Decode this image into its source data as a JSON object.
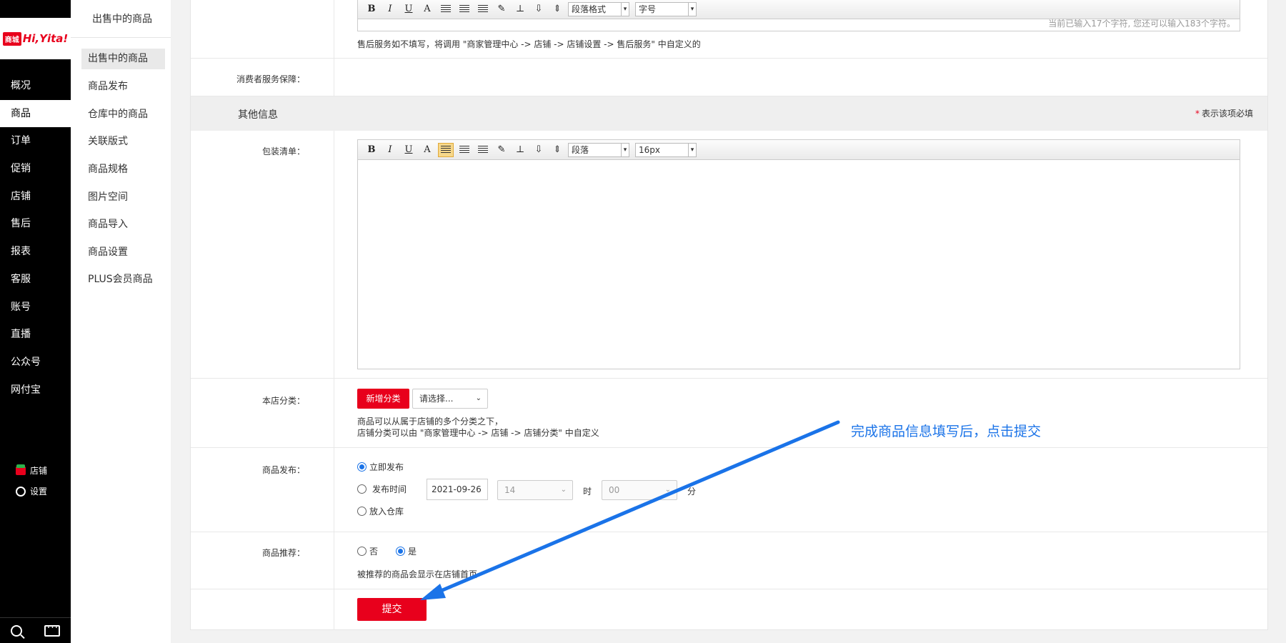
{
  "logo": {
    "mark": "商城",
    "text": "Hi,Yita!"
  },
  "main_nav": [
    "概况",
    "商品",
    "订单",
    "促销",
    "店铺",
    "售后",
    "报表",
    "客服",
    "账号",
    "直播",
    "公众号",
    "网付宝"
  ],
  "bottom_links": {
    "store": "店铺",
    "settings": "设置"
  },
  "subnav": {
    "title": "出售中的商品",
    "items": [
      "出售中的商品",
      "商品发布",
      "仓库中的商品",
      "关联版式",
      "商品规格",
      "图片空间",
      "商品导入",
      "商品设置",
      "PLUS会员商品"
    ]
  },
  "top_editor": {
    "format_select": "段落格式",
    "size_select": "字号",
    "char_count": "当前已输入17个字符, 您还可以输入183个字符。",
    "hint": "售后服务如不填写，将调用 \"商家管理中心 -> 店铺 -> 店铺设置 -> 售后服务\" 中自定义的"
  },
  "consumer_guarantee": {
    "label": "消费者服务保障："
  },
  "other_info": {
    "title": "其他信息",
    "required_star": "*",
    "required_note": "表示该项必填"
  },
  "packing_list": {
    "label": "包装清单：",
    "format_select": "段落",
    "size_select": "16px"
  },
  "toolbar_glyphs": {
    "bold": "B",
    "italic": "I",
    "underline": "U",
    "font_color": "A"
  },
  "store_category": {
    "label": "本店分类：",
    "add_button": "新增分类",
    "select_placeholder": "请选择...",
    "hint_line1": "商品可以从属于店铺的多个分类之下，",
    "hint_line2": "店铺分类可以由 \"商家管理中心 -> 店铺 -> 店铺分类\" 中自定义"
  },
  "publish": {
    "label": "商品发布：",
    "opt_now": "立即发布",
    "opt_time": "发布时间",
    "date": "2021-09-26",
    "hour": "14",
    "hour_unit": "时",
    "minute": "00",
    "minute_unit": "分",
    "opt_warehouse": "放入仓库",
    "selected": "now"
  },
  "recommend": {
    "label": "商品推荐：",
    "opt_no": "否",
    "opt_yes": "是",
    "selected": "yes",
    "hint": "被推荐的商品会显示在店铺首页"
  },
  "submit_label": "提交",
  "annotation": "完成商品信息填写后，点击提交",
  "colors": {
    "accent_red": "#e8001c",
    "annotation_blue": "#1a73e8",
    "sidebar_bg": "#000000"
  }
}
